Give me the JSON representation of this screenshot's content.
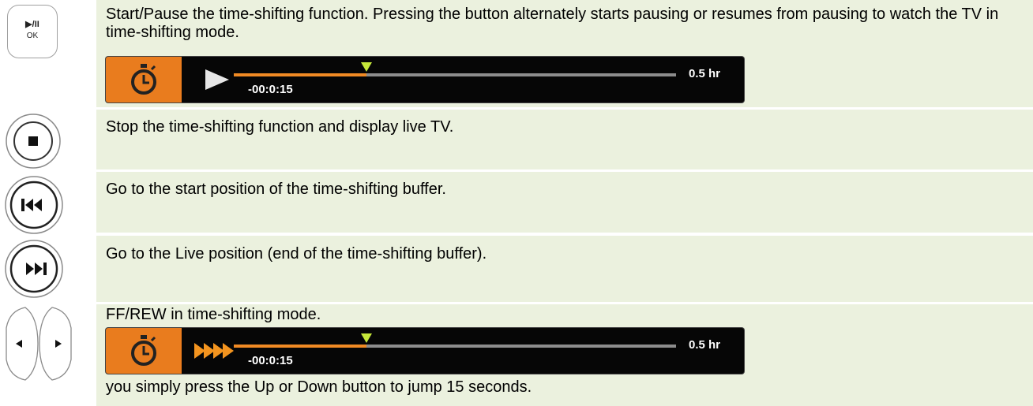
{
  "rows": [
    {
      "button": "play-pause-ok",
      "button_text": "▶/II",
      "button_subtext": "OK",
      "text": "Start/Pause the time-shifting function. Pressing the button alternately starts pausing or resumes from pausing to watch the TV in time-shifting mode.",
      "osd": {
        "icon": "play-icon",
        "elapsed": "-00:0:15",
        "total": "0.5 hr",
        "progress_fraction": 0.3
      }
    },
    {
      "button": "stop",
      "text": "Stop the time-shifting function and display live TV."
    },
    {
      "button": "skip-back",
      "text": "Go to the start position of the time-shifting buffer."
    },
    {
      "button": "skip-forward",
      "text": "Go to the Live position (end of the time-shifting buffer)."
    },
    {
      "button": "left-right-arrows",
      "text": "FF/REW in time-shifting mode.",
      "osd": {
        "icon": "fast-forward-icon",
        "elapsed": "-00:0:15",
        "total": "0.5 hr",
        "progress_fraction": 0.3
      },
      "footer_text": "you simply press the Up or Down button to jump 15 seconds."
    }
  ],
  "colors": {
    "row_bg": "#ebf1de",
    "osd_bg": "#060606",
    "accent_orange": "#e97c1e",
    "marker_green": "#c6e83a",
    "track_gray": "#8c8c8c"
  }
}
